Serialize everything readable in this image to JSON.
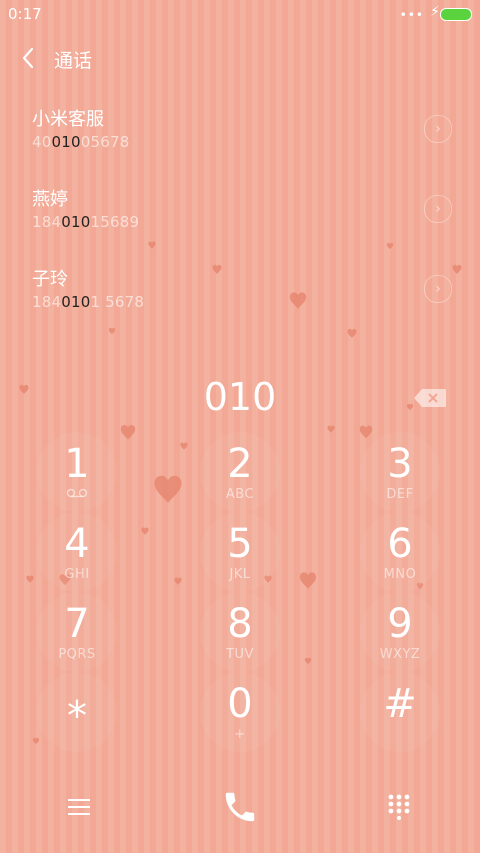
{
  "status_bar": {
    "time": "0:17",
    "signal_dots": "•••",
    "charging_icon": "⚡",
    "battery_color": "#5ad33f"
  },
  "header": {
    "title": "通话",
    "back_icon": "chevron-left-icon"
  },
  "contacts": [
    {
      "name": "小米客服",
      "number_parts": [
        "40",
        "010",
        "05678"
      ]
    },
    {
      "name": "燕婷",
      "number_parts": [
        "184",
        "010",
        "15689"
      ]
    },
    {
      "name": "子玲",
      "number_parts": [
        "184",
        "010",
        "1 5678"
      ]
    }
  ],
  "dialer": {
    "entered": "010"
  },
  "keypad": [
    {
      "digit": "1",
      "sub": ""
    },
    {
      "digit": "2",
      "sub": "ABC"
    },
    {
      "digit": "3",
      "sub": "DEF"
    },
    {
      "digit": "4",
      "sub": "GHI"
    },
    {
      "digit": "5",
      "sub": "JKL"
    },
    {
      "digit": "6",
      "sub": "MNO"
    },
    {
      "digit": "7",
      "sub": "PQRS"
    },
    {
      "digit": "8",
      "sub": "TUV"
    },
    {
      "digit": "9",
      "sub": "WXYZ"
    },
    {
      "digit": "⁎",
      "sub": ""
    },
    {
      "digit": "0",
      "sub": "+"
    },
    {
      "digit": "#",
      "sub": ""
    }
  ],
  "colors": {
    "background": "#f2a894",
    "heart": "#e6836c",
    "highlight": "#222222"
  }
}
